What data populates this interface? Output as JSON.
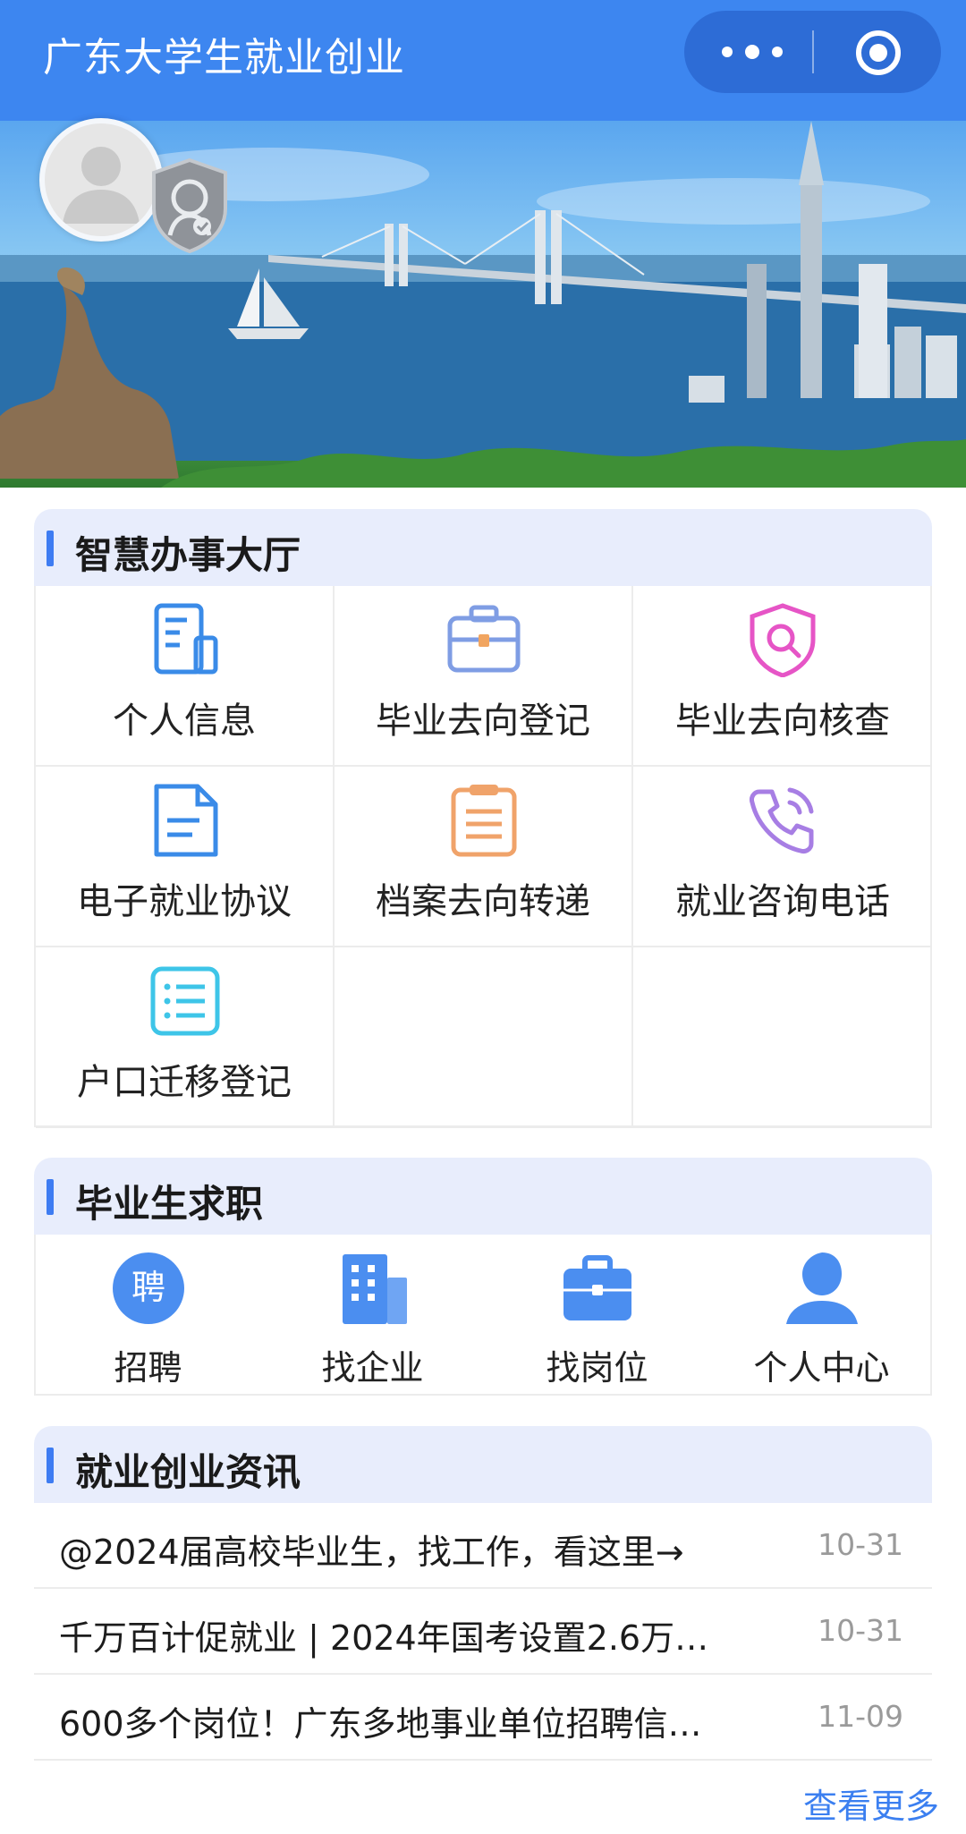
{
  "header": {
    "title": "广东大学生就业创业",
    "more_icon": "more-dots-icon",
    "close_icon": "target-circle-icon"
  },
  "profile": {
    "avatar_icon": "user-silhouette-icon",
    "badge_icon": "verified-shield-icon"
  },
  "smart_hall": {
    "title": "智慧办事大厅",
    "items": [
      {
        "label": "个人信息",
        "icon": "document-icon",
        "color": "#3a8be8"
      },
      {
        "label": "毕业去向登记",
        "icon": "briefcase-icon",
        "color": "#7f9de4"
      },
      {
        "label": "毕业去向核查",
        "icon": "shield-search-icon",
        "color": "#e655c6"
      },
      {
        "label": "电子就业协议",
        "icon": "file-icon",
        "color": "#3a8be8"
      },
      {
        "label": "档案去向转递",
        "icon": "clipboard-icon",
        "color": "#f0a36a"
      },
      {
        "label": "就业咨询电话",
        "icon": "phone-icon",
        "color": "#a77ee4"
      },
      {
        "label": "户口迁移登记",
        "icon": "list-icon",
        "color": "#3ec5e8"
      }
    ]
  },
  "job_seek": {
    "title": "毕业生求职",
    "items": [
      {
        "label": "招聘",
        "icon": "recruit-icon",
        "glyph": "聘"
      },
      {
        "label": "找企业",
        "icon": "building-icon"
      },
      {
        "label": "找岗位",
        "icon": "briefcase-icon"
      },
      {
        "label": "个人中心",
        "icon": "person-icon"
      }
    ]
  },
  "news": {
    "title": "就业创业资讯",
    "items": [
      {
        "text": "@2024届高校毕业生，找工作，看这里→",
        "date": "10-31"
      },
      {
        "text": "千万百计促就业 | 2024年国考设置2.6万…",
        "date": "10-31"
      },
      {
        "text": "600多个岗位！广东多地事业单位招聘信…",
        "date": "11-09"
      }
    ],
    "more": "查看更多"
  },
  "colors": {
    "accent": "#3e7cf2",
    "header_bg": "#3d86f0",
    "section_bg": "#e8edfc"
  }
}
